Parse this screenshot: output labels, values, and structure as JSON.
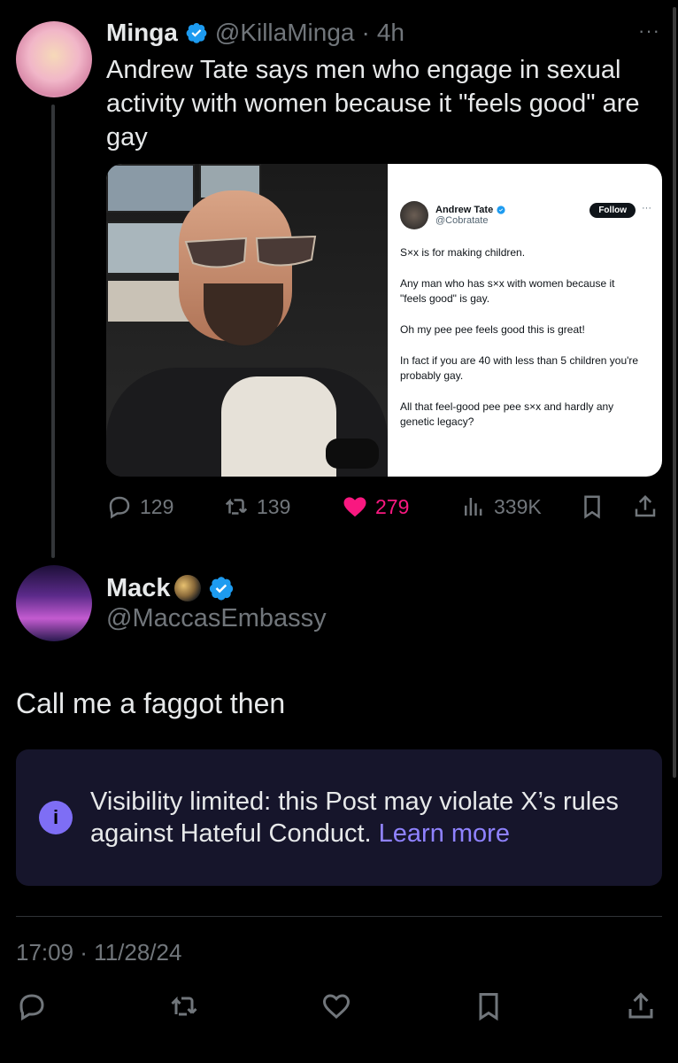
{
  "post1": {
    "name": "Minga",
    "handle": "@KillaMinga",
    "separator": "·",
    "time": "4h",
    "text": "Andrew Tate says men who engage in sexual activity with women because it \"feels good\" are gay",
    "embed": {
      "name": "Andrew Tate",
      "handle": "@Cobratate",
      "follow_label": "Follow",
      "more": "···",
      "lines": [
        "S×x is for making children.",
        "Any man who has s×x with women because it \"feels good\" is gay.",
        "Oh my pee pee feels good this is great!",
        "In fact if you are 40 with less than 5 children you're probably gay.",
        "All that feel-good pee pee s×x and hardly any genetic legacy?"
      ]
    },
    "actions": {
      "replies": "129",
      "reposts": "139",
      "likes": "279",
      "views": "339K"
    }
  },
  "post2": {
    "name": "Mack",
    "handle": "@MaccasEmbassy",
    "text": "Call me a faggot then",
    "notice": {
      "text": "Visibility limited: this Post may violate X’s rules against Hateful Conduct.",
      "link": "Learn more"
    },
    "timestamp": "17:09 · 11/28/24"
  },
  "overflow": "···",
  "colors": {
    "background": "#000000",
    "verified": "#1d9bf0",
    "like": "#f91880",
    "notice_bg": "#16152b",
    "link": "#8f82ff"
  },
  "icons": [
    "reply-icon",
    "repost-icon",
    "like-icon",
    "views-icon",
    "bookmark-icon",
    "share-icon",
    "info-icon",
    "verified-icon"
  ]
}
